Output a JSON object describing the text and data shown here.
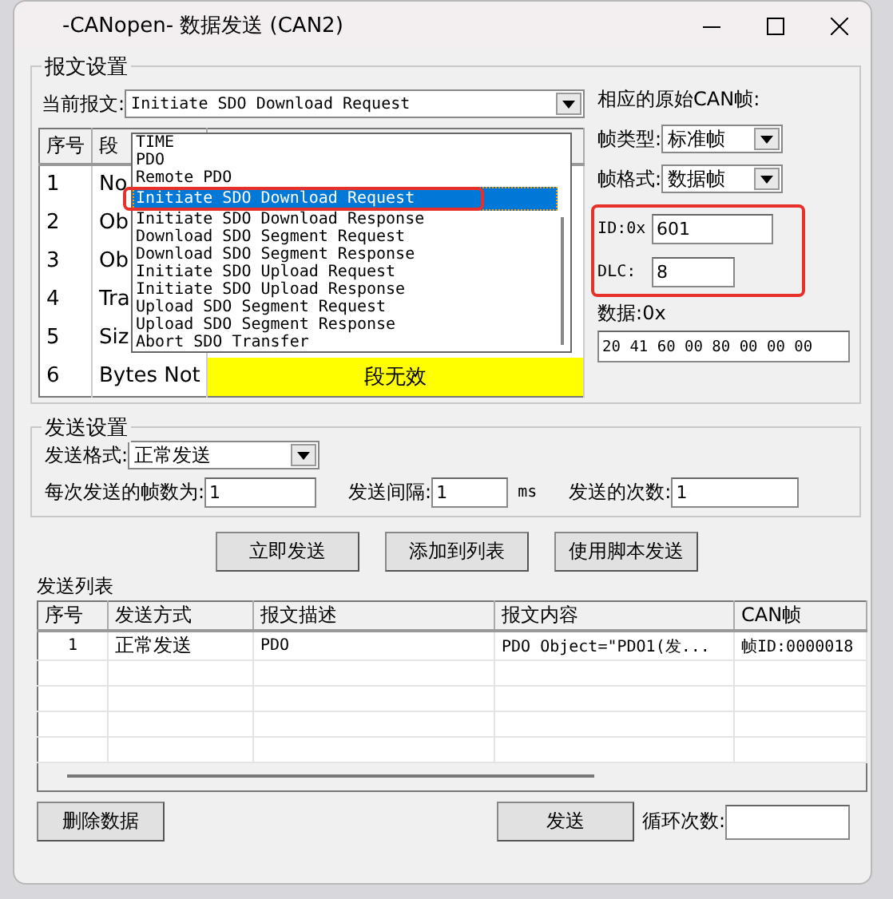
{
  "window": {
    "title": "-CANopen- 数据发送 (CAN2)"
  },
  "message_settings": {
    "title": "报文设置",
    "current_label": "当前报文:",
    "current_value": "Initiate SDO Download Request",
    "dropdown": {
      "items": [
        {
          "label": "TIME",
          "selected": false
        },
        {
          "label": "PDO",
          "selected": false
        },
        {
          "label": "Remote PDO",
          "selected": false
        },
        {
          "label": "Initiate SDO Download Request",
          "selected": true
        },
        {
          "label": "Initiate SDO Download Response",
          "selected": false
        },
        {
          "label": "Download SDO Segment Request",
          "selected": false
        },
        {
          "label": "Download SDO Segment Response",
          "selected": false
        },
        {
          "label": "Initiate SDO Upload Request",
          "selected": false
        },
        {
          "label": "Initiate SDO Upload Response",
          "selected": false
        },
        {
          "label": "Upload SDO Segment Request",
          "selected": false
        },
        {
          "label": "Upload SDO Segment Response",
          "selected": false
        },
        {
          "label": "Abort SDO Transfer",
          "selected": false
        }
      ]
    },
    "table": {
      "columns": [
        "序号",
        "段"
      ],
      "rows": [
        {
          "cells": [
            "1",
            "No"
          ]
        },
        {
          "cells": [
            "2",
            "Ob"
          ]
        },
        {
          "cells": [
            "3",
            "Ob"
          ]
        },
        {
          "cells": [
            "4",
            "Tra"
          ]
        },
        {
          "cells": [
            "5",
            "Siz"
          ]
        },
        {
          "cells": [
            "6",
            "Bytes Not"
          ],
          "status": "段无效"
        }
      ]
    },
    "raw_frame": {
      "title": "相应的原始CAN帧:",
      "type_label": "帧类型:",
      "type_value": "标准帧",
      "format_label": "帧格式:",
      "format_value": "数据帧",
      "id_label": "ID:0x",
      "id_value": "601",
      "dlc_label": "DLC:",
      "dlc_value": "8",
      "data_label": "数据:0x",
      "data_value": "20 41 60 00 80 00 00 00"
    }
  },
  "send_settings": {
    "title": "发送设置",
    "format_label": "发送格式:",
    "format_value": "正常发送",
    "frames_label": "每次发送的帧数为:",
    "frames_value": "1",
    "interval_label": "发送间隔:",
    "interval_value": "1",
    "interval_unit": "ms",
    "count_label": "发送的次数:",
    "count_value": "1"
  },
  "buttons": [
    "立即发送",
    "添加到列表",
    "使用脚本发送"
  ],
  "send_list": {
    "title": "发送列表",
    "columns": [
      "序号",
      "发送方式",
      "报文描述",
      "报文内容",
      "CAN帧"
    ],
    "rows": [
      {
        "cells": [
          "1",
          "正常发送",
          "PDO",
          "PDO Object=\"PDO1(发...",
          "帧ID:0000018"
        ]
      }
    ]
  },
  "bottom": {
    "delete_button": "删除数据",
    "send_button": "发送",
    "loop_label": "循环次数:"
  }
}
